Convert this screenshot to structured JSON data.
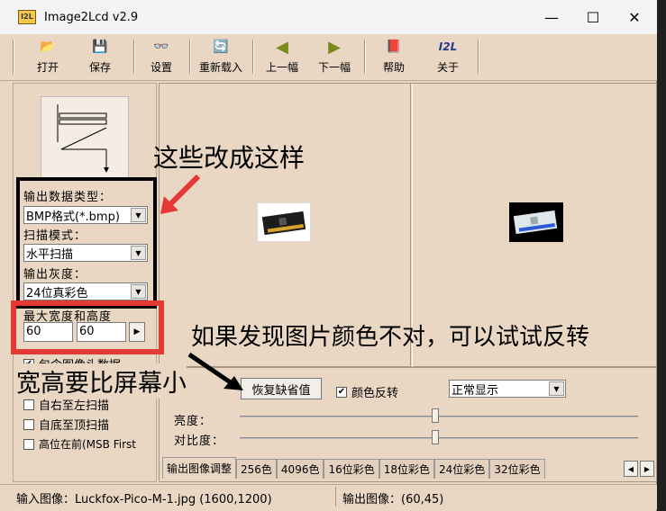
{
  "window": {
    "title": "Image2Lcd v2.9",
    "icon_text": "I2L"
  },
  "toolbar": {
    "open": "打开",
    "save": "保存",
    "settings": "设置",
    "reload": "重新载入",
    "prev": "上一幅",
    "next": "下一幅",
    "help": "帮助",
    "about": "关于",
    "about_icon_text": "I2L"
  },
  "left": {
    "output_type_label": "输出数据类型：",
    "output_type_value": "BMP格式(*.bmp)",
    "scan_mode_label": "扫描模式：",
    "scan_mode_value": "水平扫描",
    "gray_label": "输出灰度：",
    "gray_value": "24位真彩色",
    "size_label": "最大宽度和高度",
    "width": "60",
    "height": "60",
    "include_header": "包含图像头数据",
    "right_to_left": "自右至左扫描",
    "bottom_to_top": "自底至顶扫描",
    "msb_first": "高位在前(MSB First"
  },
  "controls": {
    "restore_button": "恢复缺省值",
    "invert_label": "颜色反转",
    "display_mode": "正常显示",
    "brightness_label": "亮度：",
    "contrast_label": "对比度：",
    "brightness": 0.49,
    "contrast": 0.49
  },
  "tabs": [
    "输出图像调整",
    "256色",
    "4096色",
    "16位彩色",
    "18位彩色",
    "24位彩色",
    "32位彩色"
  ],
  "status": {
    "input": "输入图像：Luckfox-Pico-M-1.jpg (1600,1200)",
    "output": "输出图像：(60,45)"
  },
  "annotations": {
    "change_these": "这些改成这样",
    "invert_hint": "如果发现图片颜色不对，可以试试反转",
    "size_hint": "宽高要比屏幕小"
  },
  "colors": {
    "window_bg": "#e9d7c4",
    "annotation_red": "#e53935"
  }
}
